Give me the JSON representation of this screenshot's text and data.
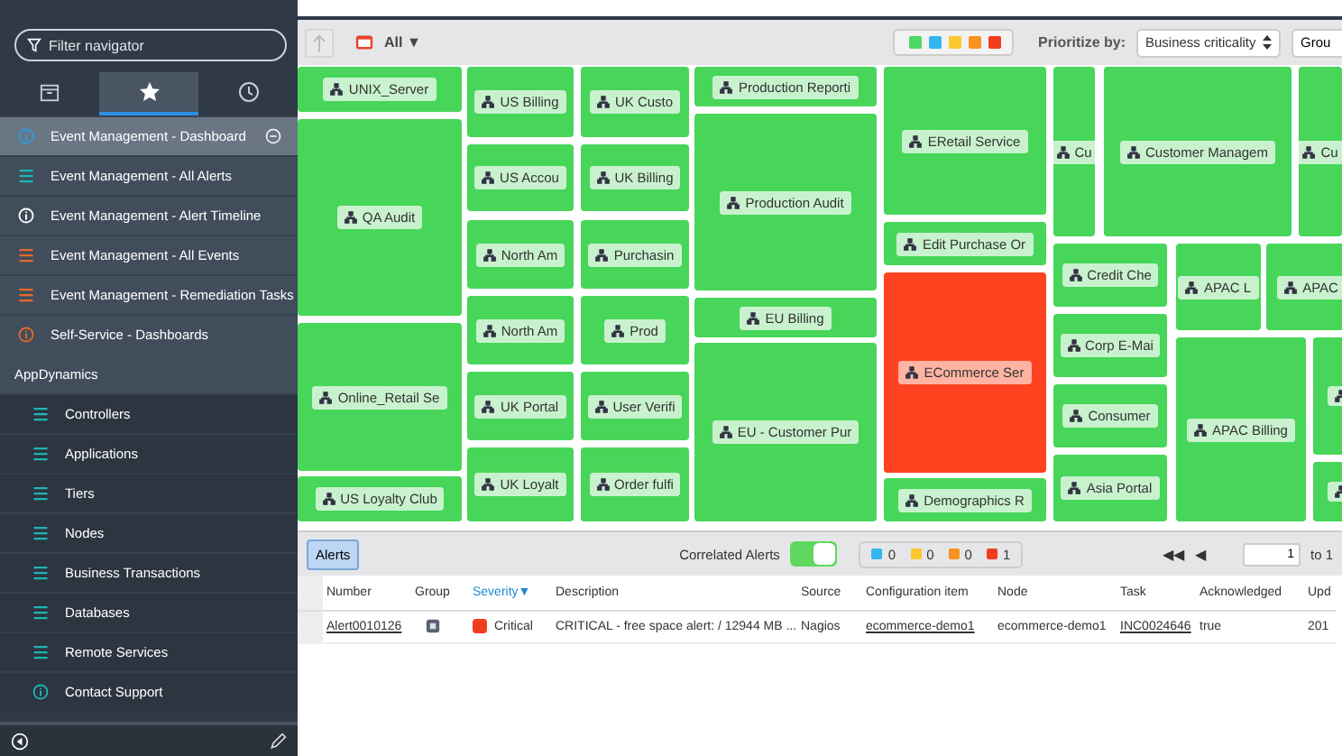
{
  "sidebar": {
    "filter": {
      "placeholder": "Filter navigator"
    },
    "tabs": [
      {
        "selected": false
      },
      {
        "selected": true
      },
      {
        "selected": false
      }
    ],
    "items": [
      {
        "label": "Event Management - Dashboard",
        "kind": "info",
        "color": "#2a9fd6",
        "selected": true
      },
      {
        "label": "Event Management - All Alerts",
        "kind": "list",
        "color": "#1fb5b5",
        "selected": false
      },
      {
        "label": "Event Management - Alert Timeline",
        "kind": "info",
        "color": "#ffffff",
        "selected": false
      },
      {
        "label": "Event Management - All Events",
        "kind": "list",
        "color": "#e8692a",
        "selected": false
      },
      {
        "label": "Event Management - Remediation Tasks",
        "kind": "list",
        "color": "#e8692a",
        "selected": false
      },
      {
        "label": "Self-Service - Dashboards",
        "kind": "info",
        "color": "#e8692a",
        "selected": false
      }
    ],
    "section": {
      "title": "AppDynamics",
      "items": [
        {
          "label": "Controllers",
          "kind": "list",
          "color": "#1fb5b5"
        },
        {
          "label": "Applications",
          "kind": "list",
          "color": "#1fb5b5"
        },
        {
          "label": "Tiers",
          "kind": "list",
          "color": "#1fb5b5"
        },
        {
          "label": "Nodes",
          "kind": "list",
          "color": "#1fb5b5"
        },
        {
          "label": "Business Transactions",
          "kind": "list",
          "color": "#1fb5b5"
        },
        {
          "label": "Databases",
          "kind": "list",
          "color": "#1fb5b5"
        },
        {
          "label": "Remote Services",
          "kind": "list",
          "color": "#1fb5b5"
        },
        {
          "label": "Contact Support",
          "kind": "info",
          "color": "#1fb5b5"
        }
      ]
    }
  },
  "toolbar": {
    "filter_label": "All",
    "filter_caret": "▼",
    "legend": [
      {
        "color": "#4cd964"
      },
      {
        "color": "#34b5f0"
      },
      {
        "color": "#fdc82f"
      },
      {
        "color": "#f7931e"
      },
      {
        "color": "#f23c1e"
      }
    ],
    "prioritize_label": "Prioritize by:",
    "prioritize_value": "Business criticality",
    "group_button": "Grou"
  },
  "treemap": {
    "tiles": [
      {
        "label": "UNIX_Server",
        "color": "#47d65a"
      },
      {
        "label": "QA Audit",
        "color": "#47d65a"
      },
      {
        "label": "Online_Retail Se",
        "color": "#47d65a"
      },
      {
        "label": "US Loyalty Club",
        "color": "#47d65a"
      },
      {
        "label": "US Billing",
        "color": "#47d65a"
      },
      {
        "label": "US Accou",
        "color": "#47d65a"
      },
      {
        "label": "North Am",
        "color": "#47d65a"
      },
      {
        "label": "North Am",
        "color": "#47d65a"
      },
      {
        "label": "UK Portal",
        "color": "#47d65a"
      },
      {
        "label": "UK Loyalt",
        "color": "#47d65a"
      },
      {
        "label": "UK Custo",
        "color": "#47d65a"
      },
      {
        "label": "UK Billing",
        "color": "#47d65a"
      },
      {
        "label": "Purchasin",
        "color": "#47d65a"
      },
      {
        "label": "Prod",
        "color": "#47d65a"
      },
      {
        "label": "User Verifi",
        "color": "#47d65a"
      },
      {
        "label": "Order fulfi",
        "color": "#47d65a"
      },
      {
        "label": "Production Reporti",
        "color": "#47d65a"
      },
      {
        "label": "Production Audit",
        "color": "#47d65a"
      },
      {
        "label": "EU Billing",
        "color": "#47d65a"
      },
      {
        "label": "EU - Customer Pur",
        "color": "#47d65a"
      },
      {
        "label": "ERetail Service",
        "color": "#47d65a"
      },
      {
        "label": "Edit Purchase Or",
        "color": "#47d65a"
      },
      {
        "label": "ECommerce Ser",
        "color": "#ff421f"
      },
      {
        "label": "Demographics R",
        "color": "#47d65a"
      },
      {
        "label": "Cu",
        "color": "#47d65a"
      },
      {
        "label": "Customer Managem",
        "color": "#47d65a"
      },
      {
        "label": "Cu",
        "color": "#47d65a"
      },
      {
        "label": "Credit Che",
        "color": "#47d65a"
      },
      {
        "label": "Corp E-Mai",
        "color": "#47d65a"
      },
      {
        "label": "Consumer",
        "color": "#47d65a"
      },
      {
        "label": "Asia Portal",
        "color": "#47d65a"
      },
      {
        "label": "APAC L",
        "color": "#47d65a"
      },
      {
        "label": "APAC",
        "color": "#47d65a"
      },
      {
        "label": "APAC Billing",
        "color": "#47d65a"
      },
      {
        "color": "#47d65a"
      },
      {
        "color": "#47d65a"
      }
    ]
  },
  "alerts_bar": {
    "alerts_button": {
      "label": "Alerts",
      "selected": true
    },
    "correlated_label": "Correlated Alerts",
    "correlated_on": true,
    "counts": [
      {
        "color": "#34b5f0",
        "count": "0"
      },
      {
        "color": "#fdc82f",
        "count": "0"
      },
      {
        "color": "#f7931e",
        "count": "0"
      },
      {
        "color": "#f23c1e",
        "count": "1"
      }
    ],
    "first_glyph": "◀◀",
    "prev_glyph": "◀",
    "page_value": "1",
    "page_to": "to 1"
  },
  "table": {
    "columns": [
      {
        "label": "Number",
        "sorted": false
      },
      {
        "label": "Group",
        "sorted": false
      },
      {
        "label": "Severity",
        "sorted": true,
        "sort_glyph": "▼"
      },
      {
        "label": "Description",
        "sorted": false
      },
      {
        "label": "Source",
        "sorted": false
      },
      {
        "label": "Configuration item",
        "sorted": false
      },
      {
        "label": "Node",
        "sorted": false
      },
      {
        "label": "Task",
        "sorted": false
      },
      {
        "label": "Acknowledged",
        "sorted": false
      },
      {
        "label": "Upd",
        "sorted": false
      }
    ],
    "rows": [
      {
        "number": "Alert0010126",
        "severity": "Critical",
        "color": "#f23c1e",
        "description": "CRITICAL - free space alert: / 12944 MB ...",
        "source": "Nagios",
        "ci": "ecommerce-demo1",
        "node": "ecommerce-demo1",
        "task": "INC0024646",
        "acknowledged": "true",
        "updated": "201"
      }
    ]
  }
}
